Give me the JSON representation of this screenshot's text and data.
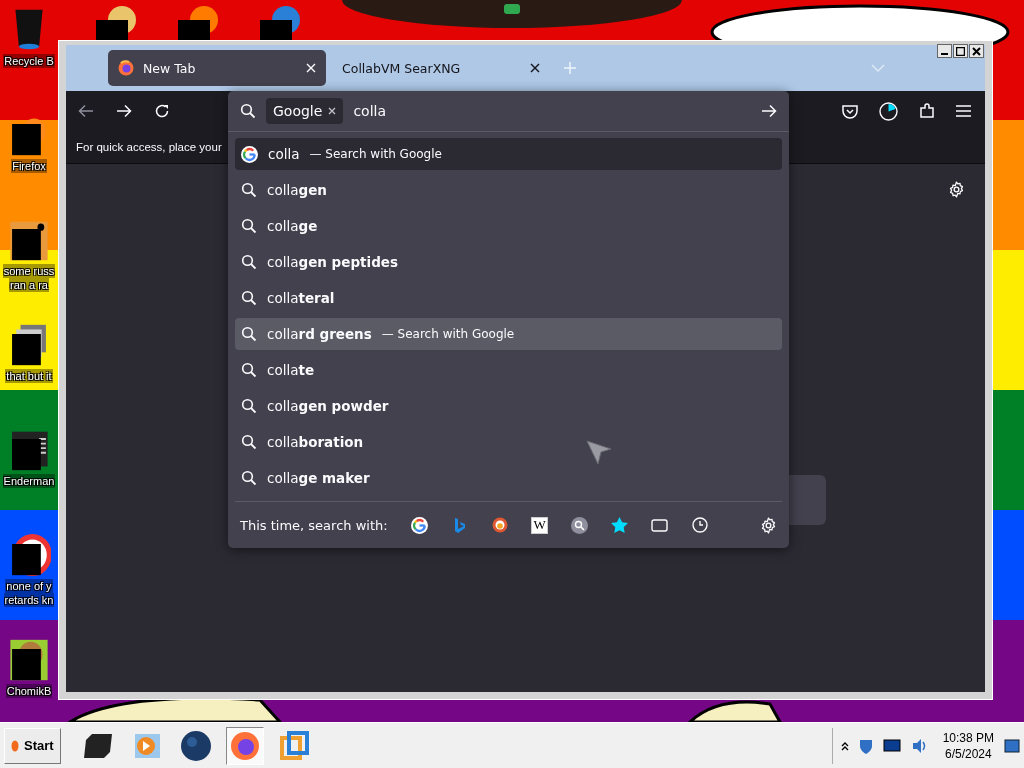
{
  "desktop": {
    "icons": [
      {
        "lines": [
          "Recycle B"
        ],
        "kind": "bin"
      },
      {
        "lines": [
          "Firefox"
        ],
        "kind": "fox"
      },
      {
        "lines": [
          "some russ",
          "ran a ra"
        ],
        "kind": "orange"
      },
      {
        "lines": [
          "that but it"
        ],
        "kind": "stack"
      },
      {
        "lines": [
          "Enderman"
        ],
        "kind": "terminal"
      },
      {
        "lines": [
          "none of y",
          "retards kn"
        ],
        "kind": "ring"
      },
      {
        "lines": [
          "ChomikB"
        ],
        "kind": "hamster"
      }
    ]
  },
  "browser": {
    "tabs": [
      {
        "label": "New Tab",
        "selected": true
      },
      {
        "label": "CollabVM SearXNG",
        "selected": false
      }
    ],
    "bookmarks_hint": "For quick access, place your",
    "urlbar": {
      "engine_chip": "Google",
      "value": "colla"
    },
    "suggestions": [
      {
        "kind": "heuristic",
        "text": "colla",
        "action": "— Search with Google",
        "selected": true,
        "hovered": false
      },
      {
        "kind": "suggestion",
        "text": "colla**gen**",
        "selected": false,
        "hovered": false
      },
      {
        "kind": "suggestion",
        "text": "colla**ge**",
        "selected": false,
        "hovered": false
      },
      {
        "kind": "suggestion",
        "text": "colla**gen peptides**",
        "selected": false,
        "hovered": false
      },
      {
        "kind": "suggestion",
        "text": "colla**teral**",
        "selected": false,
        "hovered": false
      },
      {
        "kind": "suggestion",
        "text": "colla**rd greens**",
        "action": "— Search with Google",
        "selected": false,
        "hovered": true
      },
      {
        "kind": "suggestion",
        "text": "colla**te**",
        "selected": false,
        "hovered": false
      },
      {
        "kind": "suggestion",
        "text": "colla**gen powder**",
        "selected": false,
        "hovered": false
      },
      {
        "kind": "suggestion",
        "text": "colla**boration**",
        "selected": false,
        "hovered": false
      },
      {
        "kind": "suggestion",
        "text": "colla**ge maker**",
        "selected": false,
        "hovered": false
      }
    ],
    "one_off": {
      "label": "This time, search with:",
      "buttons": [
        {
          "kind": "google"
        },
        {
          "kind": "bing"
        },
        {
          "kind": "duckduckgo"
        },
        {
          "kind": "wikipedia",
          "glyph": "W"
        },
        {
          "kind": "searx"
        },
        {
          "kind": "bookmarks"
        },
        {
          "kind": "tabs"
        },
        {
          "kind": "history"
        }
      ]
    }
  },
  "taskbar": {
    "start": "Start",
    "time": "10:38 PM",
    "date": "6/5/2024"
  }
}
